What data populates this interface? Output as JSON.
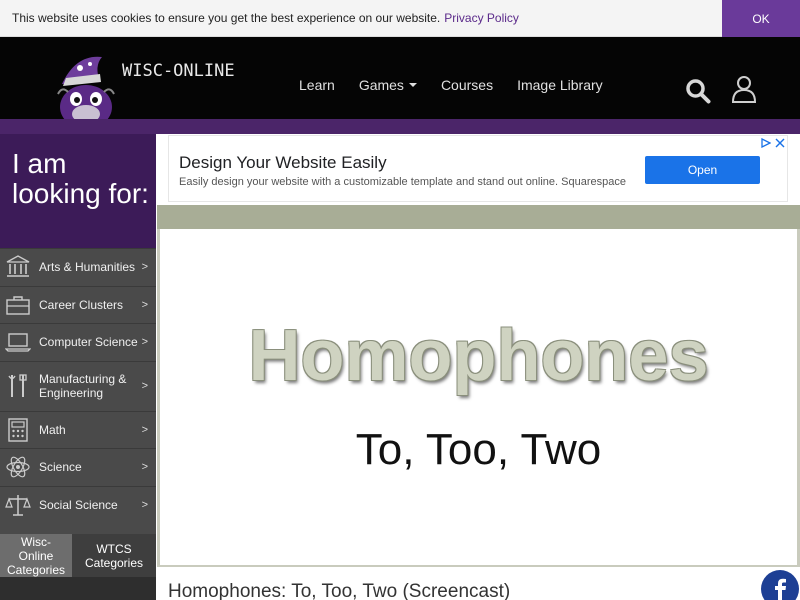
{
  "cookie": {
    "message": "This website uses cookies to ensure you get the best experience on our website.",
    "link": "Privacy Policy",
    "ok_label": "OK"
  },
  "header": {
    "logo_text": "WISC-ONLINE",
    "nav": [
      {
        "label": "Learn",
        "icon": ""
      },
      {
        "label": "Games",
        "icon": "chevron-down-icon"
      },
      {
        "label": "Courses",
        "icon": ""
      },
      {
        "label": "Image Library",
        "icon": ""
      }
    ],
    "icons": {
      "search": "search-icon",
      "user": "user-icon"
    }
  },
  "sidebar": {
    "heading": "I am looking for:",
    "categories": [
      {
        "label": "Arts & Humanities",
        "icon": "building-columns-icon",
        "arrow": ">"
      },
      {
        "label": "Career Clusters",
        "icon": "briefcase-icon",
        "arrow": ">"
      },
      {
        "label": "Computer Science",
        "icon": "laptop-icon",
        "arrow": ">"
      },
      {
        "label": "Manufacturing & Engineering",
        "icon": "tools-icon",
        "arrow": ">"
      },
      {
        "label": "Math",
        "icon": "calculator-icon",
        "arrow": ">"
      },
      {
        "label": "Science",
        "icon": "atom-icon",
        "arrow": ">"
      },
      {
        "label": "Social Science",
        "icon": "scales-icon",
        "arrow": ">"
      }
    ],
    "tabs": [
      {
        "label": "Wisc-Online Categories",
        "active": true
      },
      {
        "label": "WTCS Categories",
        "active": false
      }
    ]
  },
  "ad": {
    "title": "Design Your Website Easily",
    "description": "Easily design your website with a customizable template and stand out online. Squarespace",
    "button": "Open"
  },
  "video": {
    "title": "Homophones",
    "subtitle": "To, Too, Two"
  },
  "page": {
    "title": "Homophones: To, Too, Two (Screencast)"
  },
  "colors": {
    "accent": "#6a3a9a",
    "header_bg": "#050505",
    "sidebar_heading_bg": "#3c1b58",
    "sidebar_bg": "#4a4a4a",
    "ad_button": "#1a73e8",
    "facebook": "#1d3f94"
  }
}
